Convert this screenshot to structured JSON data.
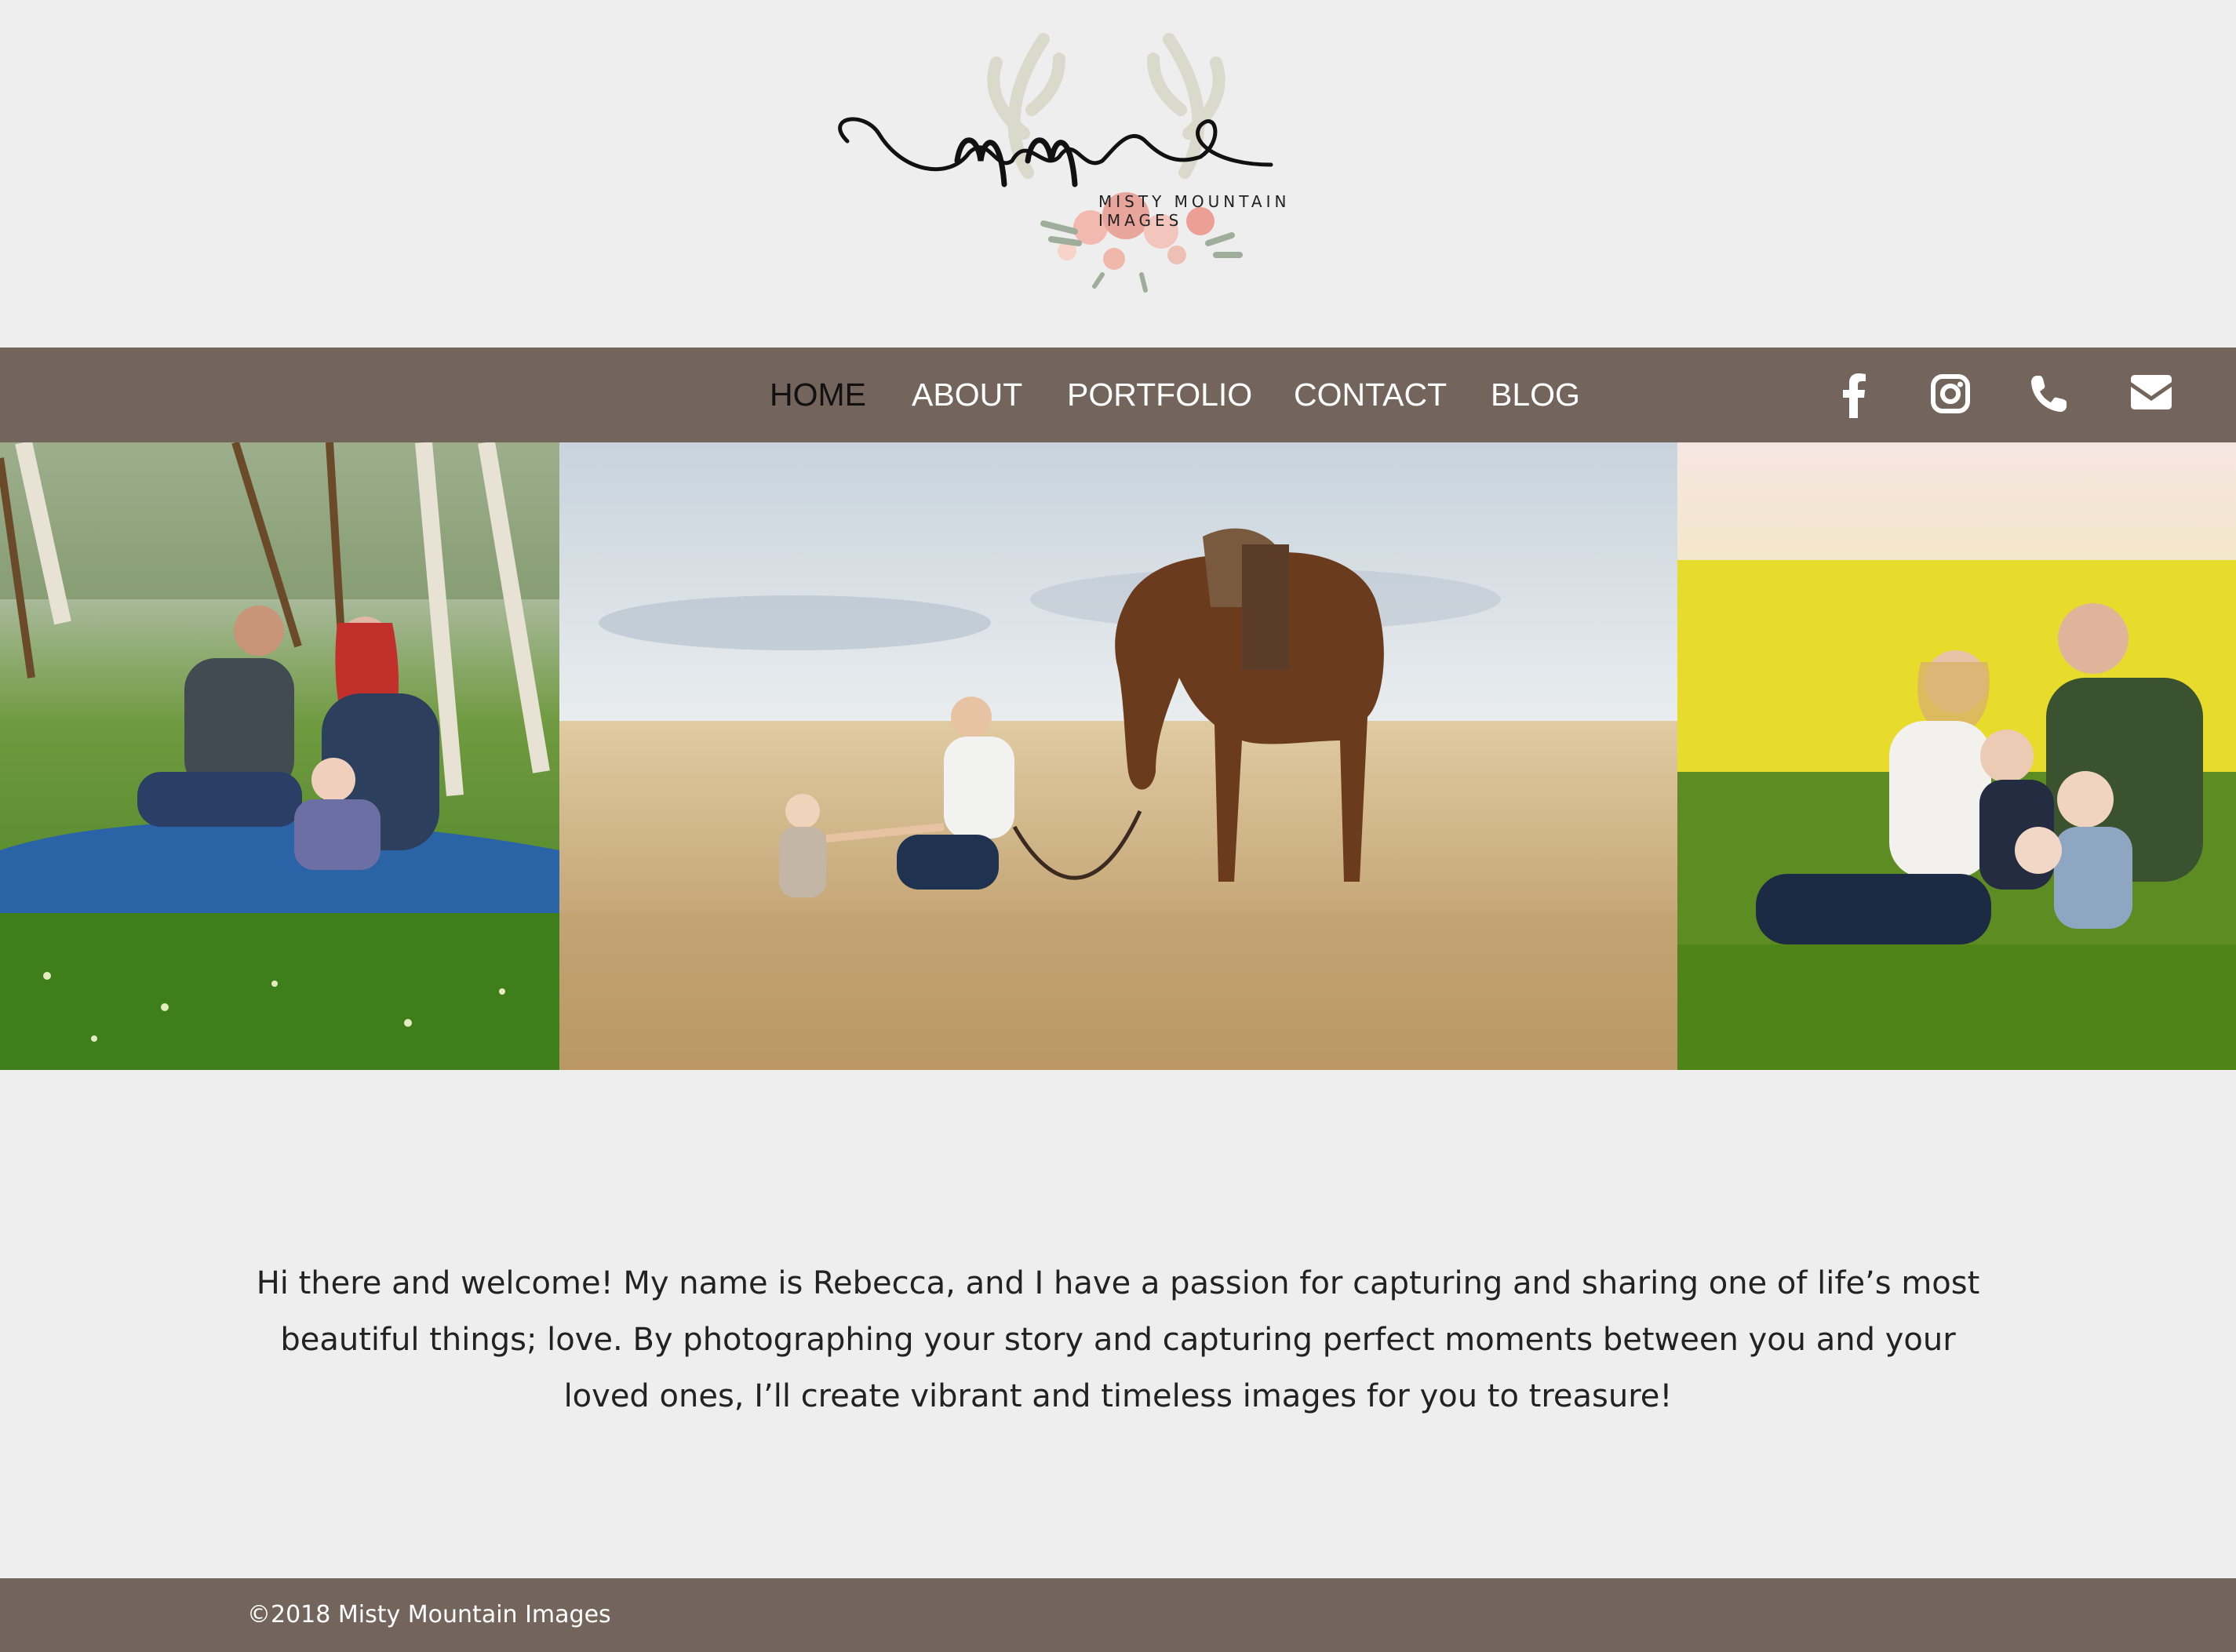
{
  "logo": {
    "monogram": "mm",
    "text": "MISTY MOUNTAIN IMAGES"
  },
  "nav": {
    "items": [
      {
        "label": "HOME",
        "active": true
      },
      {
        "label": "ABOUT",
        "active": false
      },
      {
        "label": "PORTFOLIO",
        "active": false
      },
      {
        "label": "CONTACT",
        "active": false
      },
      {
        "label": "BLOG",
        "active": false
      }
    ],
    "social": [
      "facebook-icon",
      "instagram-icon",
      "phone-icon",
      "email-icon"
    ]
  },
  "photos": [
    {
      "name": "family-in-grass-photo"
    },
    {
      "name": "mother-child-horse-photo"
    },
    {
      "name": "family-in-canola-field-photo"
    }
  ],
  "welcome": {
    "text": "Hi there and welcome! My name is Rebecca, and I have a passion for capturing and sharing one of life’s most beautiful things; love. By photographing your story and capturing perfect moments between you and your loved ones, I’ll create vibrant and timeless images for you to treasure!"
  },
  "footer": {
    "copyright": "©2018 Misty Mountain Images"
  },
  "colors": {
    "background": "#eeeeee",
    "bar": "#73655b",
    "nav_text": "#ffffff",
    "nav_active": "#111111"
  }
}
